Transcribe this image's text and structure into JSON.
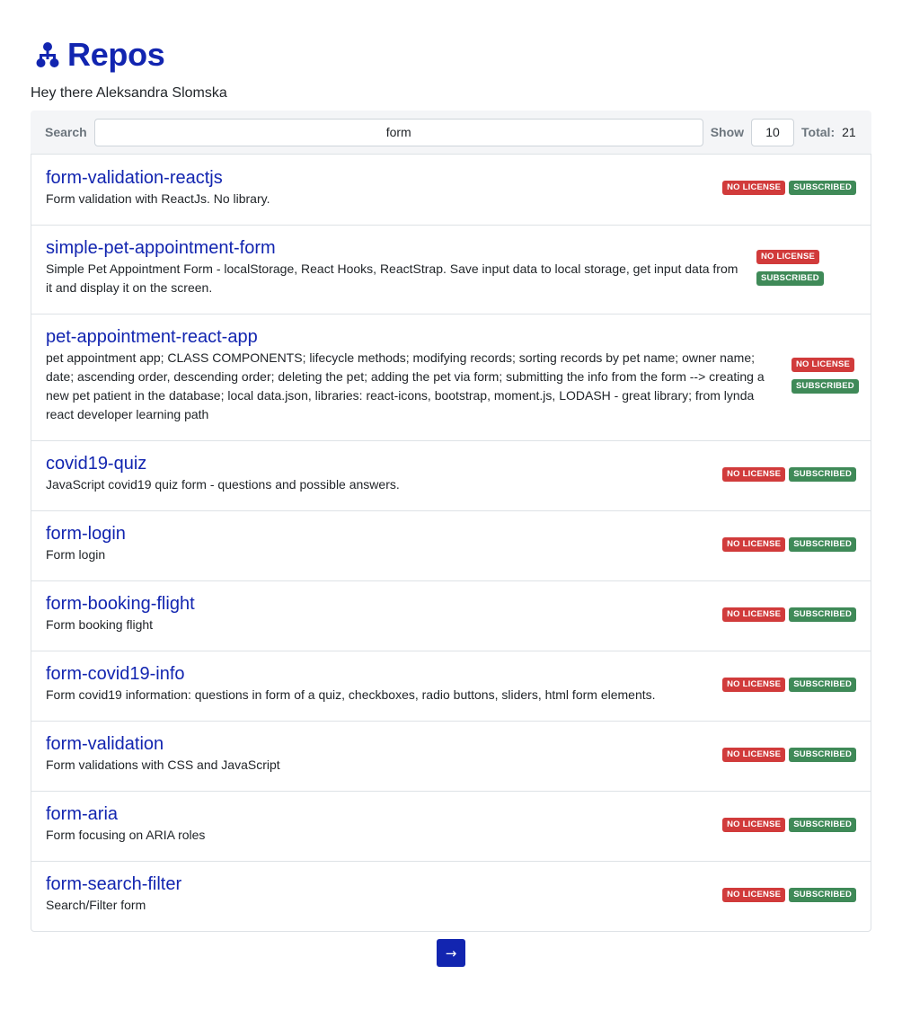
{
  "header": {
    "title": "Repos",
    "icon": "org-tree-icon"
  },
  "greeting": "Hey there Aleksandra Slomska",
  "toolbar": {
    "search_label": "Search",
    "search_value": "form",
    "show_label": "Show",
    "show_value": "10",
    "total_label": "Total:",
    "total_value": "21"
  },
  "badges": {
    "license": "NO LICENSE",
    "subscribed": "SUBSCRIBED"
  },
  "colors": {
    "accent": "#1225b0",
    "license_badge": "#d13b3b",
    "subscribed_badge": "#3f8a58"
  },
  "repos": [
    {
      "name": "form-validation-reactjs",
      "description": "Form validation with ReactJs. No library."
    },
    {
      "name": "simple-pet-appointment-form",
      "description": "Simple Pet Appointment Form - localStorage, React Hooks, ReactStrap. Save input data to local storage, get input data from it and display it on the screen."
    },
    {
      "name": "pet-appointment-react-app",
      "description": "pet appointment app; CLASS COMPONENTS; lifecycle methods; modifying records; sorting records by pet name; owner name; date; ascending order, descending order; deleting the pet; adding the pet via form; submitting the info from the form --> creating a new pet patient in the database; local data.json, libraries: react-icons, bootstrap, moment.js, LODASH - great library; from lynda react developer learning path"
    },
    {
      "name": "covid19-quiz",
      "description": "JavaScript covid19 quiz form - questions and possible answers."
    },
    {
      "name": "form-login",
      "description": "Form login"
    },
    {
      "name": "form-booking-flight",
      "description": "Form booking flight"
    },
    {
      "name": "form-covid19-info",
      "description": "Form covid19 information: questions in form of a quiz, checkboxes, radio buttons, sliders, html form elements."
    },
    {
      "name": "form-validation",
      "description": "Form validations with CSS and JavaScript"
    },
    {
      "name": "form-aria",
      "description": "Form focusing on ARIA roles"
    },
    {
      "name": "form-search-filter",
      "description": "Search/Filter form"
    }
  ],
  "pager": {
    "next_icon": "arrow-right-icon",
    "next_glyph": "→"
  }
}
